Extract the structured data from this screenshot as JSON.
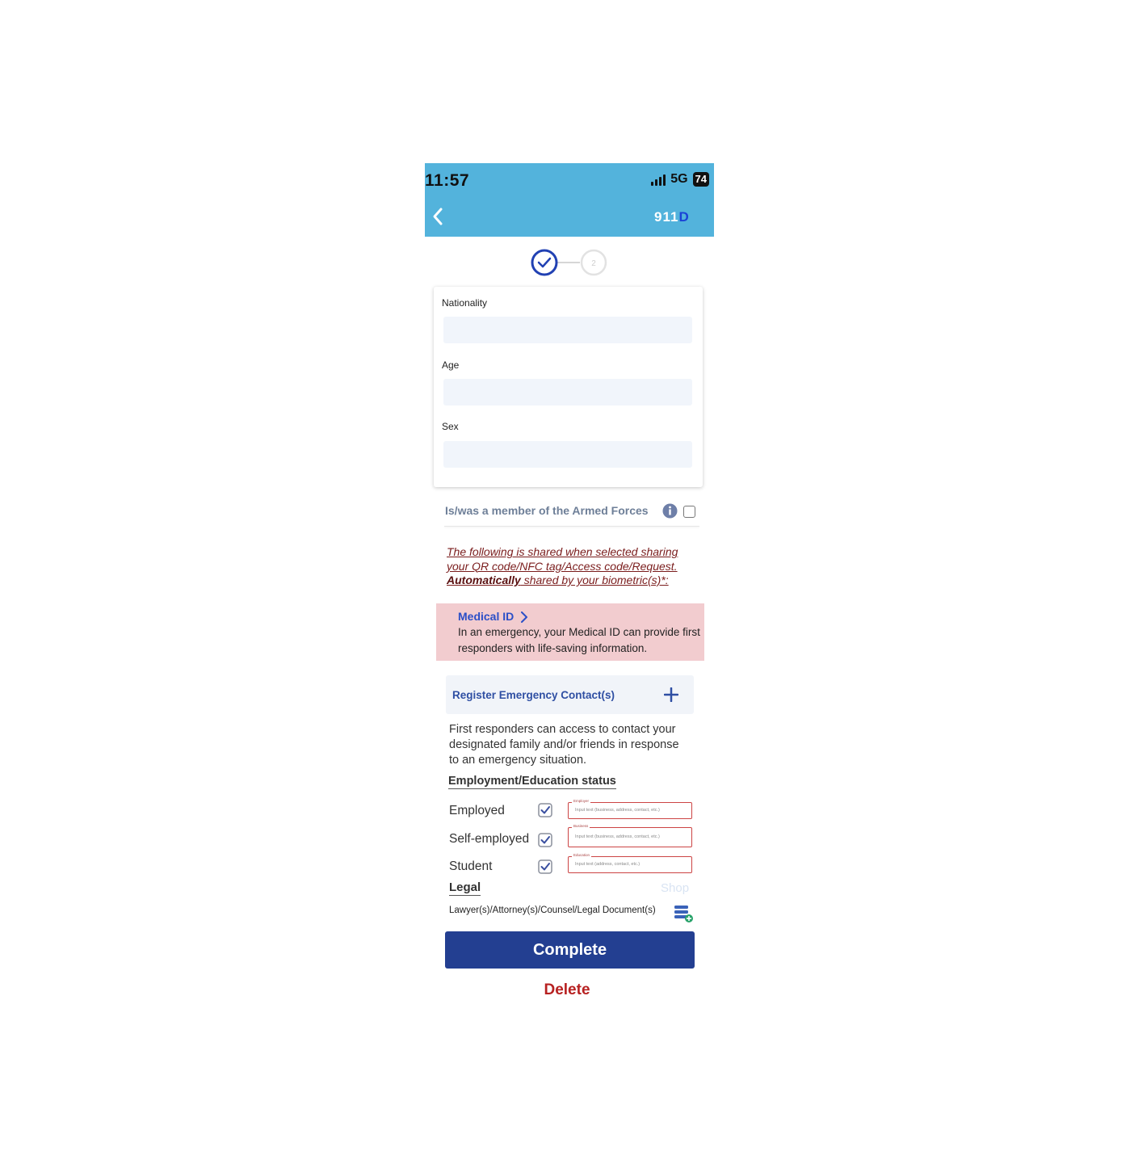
{
  "status_bar": {
    "time": "11:57",
    "network": "5G",
    "battery": "74"
  },
  "header": {
    "brand_text": "911",
    "brand_suffix": "D",
    "accent_color": "#53b3dc",
    "back_icon": "chevron-left-icon"
  },
  "stepper": {
    "current_step": 1,
    "step2_label": "2"
  },
  "form": {
    "nationality_label": "Nationality",
    "nationality_value": "",
    "age_label": "Age",
    "age_value": "",
    "sex_label": "Sex",
    "sex_value": ""
  },
  "armed_forces": {
    "label": "Is/was a member of the Armed Forces",
    "checked": false
  },
  "sharing_notice": {
    "line1": "The following is shared when selected sharing your QR code/NFC tag/Access code/Request.",
    "auto_bold": "Automatically",
    "auto_rest": " shared by your biometric(s)*:"
  },
  "medical_id": {
    "title": "Medical ID",
    "description": "In an emergency, your Medical ID can provide first responders with life-saving information."
  },
  "emergency": {
    "register_label": "Register Emergency Contact(s)",
    "description": "First responders can access to contact your designated family and/or friends in response to an emergency situation."
  },
  "employment": {
    "title": "Employment/Education status",
    "rows": [
      {
        "label": "Employed",
        "checked": true,
        "field_label": "Employer",
        "placeholder": "Input text (business, address, contact, etc.)"
      },
      {
        "label": "Self-employed",
        "checked": true,
        "field_label": "Business",
        "placeholder": "Input text (business, address, contact, etc.)"
      },
      {
        "label": "Student",
        "checked": true,
        "field_label": "Education",
        "placeholder": "Input text (address, contact, etc.)"
      }
    ]
  },
  "legal": {
    "title": "Legal",
    "shop_link": "Shop",
    "documents_label": "Lawyer(s)/Attorney(s)/Counsel/Legal Document(s)"
  },
  "actions": {
    "complete_label": "Complete",
    "delete_label": "Delete"
  }
}
